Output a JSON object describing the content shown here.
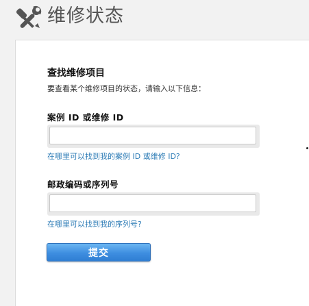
{
  "header": {
    "icon": "wrench-screwdriver-icon",
    "title": "维修状态"
  },
  "form": {
    "section_title": "查找维修项目",
    "section_desc": "要查看某个维修项目的状态，请输入以下信息：",
    "case_field": {
      "label": "案例 ID 或维修 ID",
      "value": "",
      "help_link": "在哪里可以找到我的案例 ID 或维修 ID?"
    },
    "serial_field": {
      "label": "邮政编码或序列号",
      "value": "",
      "help_link": "在哪里可以找到我的序列号?"
    },
    "submit_label": "提交"
  },
  "colors": {
    "link": "#2a7ab5",
    "button": "#3e8ee0",
    "page_background": "#f2f2f2"
  }
}
